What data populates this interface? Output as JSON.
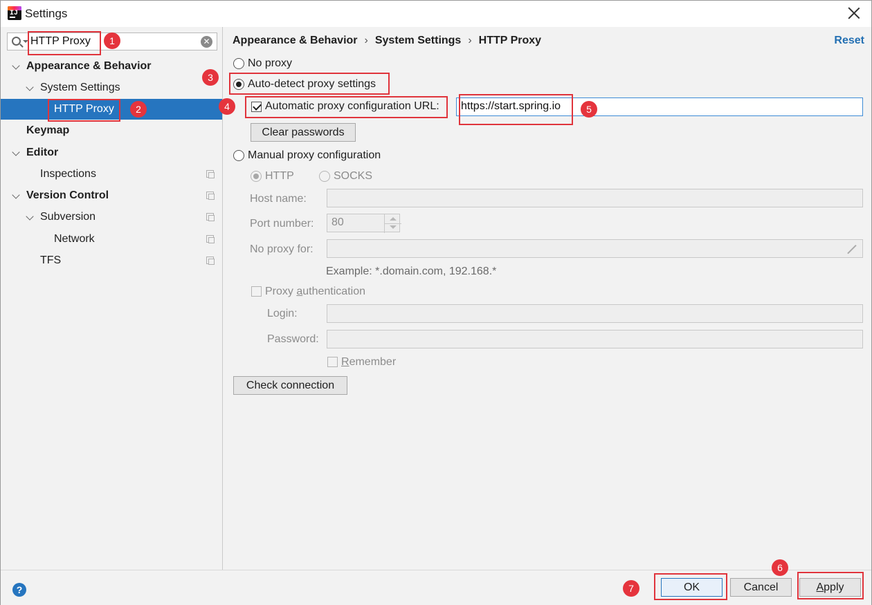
{
  "window": {
    "title": "Settings",
    "app_icon": "intellij-idea-icon"
  },
  "search": {
    "value": "HTTP Proxy"
  },
  "sidebar": {
    "items": [
      {
        "label": "Appearance & Behavior"
      },
      {
        "label": "System Settings"
      },
      {
        "label": "HTTP Proxy"
      },
      {
        "label": "Keymap"
      },
      {
        "label": "Editor"
      },
      {
        "label": "Inspections"
      },
      {
        "label": "Version Control"
      },
      {
        "label": "Subversion"
      },
      {
        "label": "Network"
      },
      {
        "label": "TFS"
      }
    ]
  },
  "breadcrumb": {
    "items": [
      "Appearance & Behavior",
      "System Settings",
      "HTTP Proxy"
    ],
    "separator": "›"
  },
  "reset_label": "Reset",
  "proxy": {
    "no_proxy": "No proxy",
    "auto_detect": "Auto-detect proxy settings",
    "auto_config_url_label": "Automatic proxy configuration URL:",
    "auto_config_url_value": "https://start.spring.io",
    "clear_passwords": "Clear passwords",
    "manual": "Manual proxy configuration",
    "http": "HTTP",
    "socks": "SOCKS",
    "host_name": "Host name:",
    "port_number": "Port number:",
    "port_value": "80",
    "no_proxy_for": "No proxy for:",
    "example": "Example: *.domain.com, 192.168.*",
    "proxy_auth_pre": "Proxy ",
    "proxy_auth_u": "a",
    "proxy_auth_post": "uthentication",
    "login": "Login:",
    "password": "Password:",
    "remember_u": "R",
    "remember_post": "emember",
    "check_connection": "Check connection"
  },
  "footer": {
    "ok": "OK",
    "cancel": "Cancel",
    "apply_u": "A",
    "apply_post": "pply"
  },
  "annotations": {
    "b1": "1",
    "b2": "2",
    "b3": "3",
    "b4": "4",
    "b5": "5",
    "b6": "6",
    "b7": "7"
  },
  "colors": {
    "selection": "#2675bf",
    "annotation": "#e0343c",
    "link": "#2470b3"
  }
}
